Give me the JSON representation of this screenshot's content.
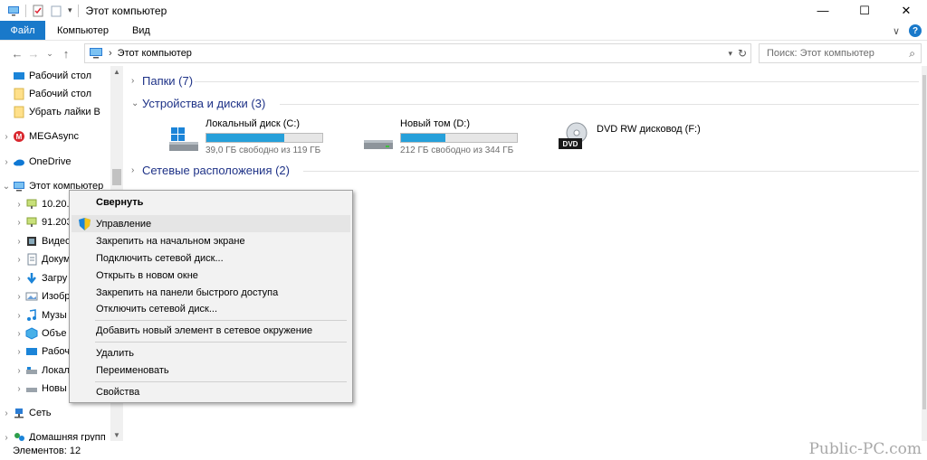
{
  "window": {
    "title": "Этот компьютер",
    "buttons": {
      "minimize": "—",
      "maximize": "☐",
      "close": "✕"
    }
  },
  "ribbon": {
    "tabs": [
      "Файл",
      "Компьютер",
      "Вид"
    ],
    "expand": "∨",
    "help": "?"
  },
  "address": {
    "path": "Этот компьютер",
    "separator": "›",
    "search_placeholder": "Поиск: Этот компьютер"
  },
  "nav": {
    "items": [
      {
        "label": "Рабочий стол",
        "icon": "desktop-icon"
      },
      {
        "label": "Рабочий стол",
        "icon": "folder-icon"
      },
      {
        "label": "Убрать лайки В",
        "icon": "folder-icon"
      },
      {
        "label": "MEGAsync",
        "icon": "mega-icon"
      },
      {
        "label": "OneDrive",
        "icon": "cloud-icon"
      },
      {
        "label": "Этот компьютер",
        "icon": "computer-icon"
      },
      {
        "label": "10.20.",
        "icon": "network-drive-icon"
      },
      {
        "label": "91.203",
        "icon": "network-drive-icon"
      },
      {
        "label": "Видео",
        "icon": "video-icon"
      },
      {
        "label": "Докум",
        "icon": "documents-icon"
      },
      {
        "label": "Загру",
        "icon": "download-icon"
      },
      {
        "label": "Изобр",
        "icon": "pictures-icon"
      },
      {
        "label": "Музы",
        "icon": "music-icon"
      },
      {
        "label": "Объе",
        "icon": "3d-objects-icon"
      },
      {
        "label": "Рабоч",
        "icon": "desktop-icon"
      },
      {
        "label": "Локал",
        "icon": "drive-icon"
      },
      {
        "label": "Новы",
        "icon": "drive-icon"
      },
      {
        "label": "Сеть",
        "icon": "network-icon"
      },
      {
        "label": "Домашняя групп",
        "icon": "homegroup-icon"
      }
    ]
  },
  "main": {
    "groups": [
      {
        "label": "Папки (7)"
      },
      {
        "label": "Устройства и диски (3)"
      },
      {
        "label": "Сетевые расположения (2)"
      }
    ],
    "drives": [
      {
        "name": "Локальный диск (C:)",
        "free": "39,0 ГБ свободно из 119 ГБ",
        "used_fraction": 0.67,
        "icon": "windows-drive-icon"
      },
      {
        "name": "Новый том (D:)",
        "free": "212 ГБ свободно из 344 ГБ",
        "used_fraction": 0.38,
        "icon": "drive-icon"
      },
      {
        "name": "DVD RW дисковод (F:)",
        "free": "",
        "icon": "dvd-drive-icon",
        "badge": "DVD"
      }
    ]
  },
  "context_menu": {
    "items": [
      {
        "label": "Свернуть"
      },
      {
        "label": "Управление"
      },
      {
        "label": "Закрепить на начальном экране"
      },
      {
        "label": "Подключить сетевой диск..."
      },
      {
        "label": "Открыть в новом окне"
      },
      {
        "label": "Закрепить на панели быстрого доступа"
      },
      {
        "label": "Отключить сетевой диск..."
      },
      {
        "label": "Добавить новый элемент в сетевое окружение"
      },
      {
        "label": "Удалить"
      },
      {
        "label": "Переименовать"
      },
      {
        "label": "Свойства"
      }
    ]
  },
  "status": {
    "items_count": "Элементов: 12"
  },
  "watermark": "Public-PC.com",
  "colors": {
    "accent": "#1979ca",
    "bar_fill": "#26a0da",
    "group_header": "#1e3287",
    "menu_bg": "#f2f2f2"
  }
}
